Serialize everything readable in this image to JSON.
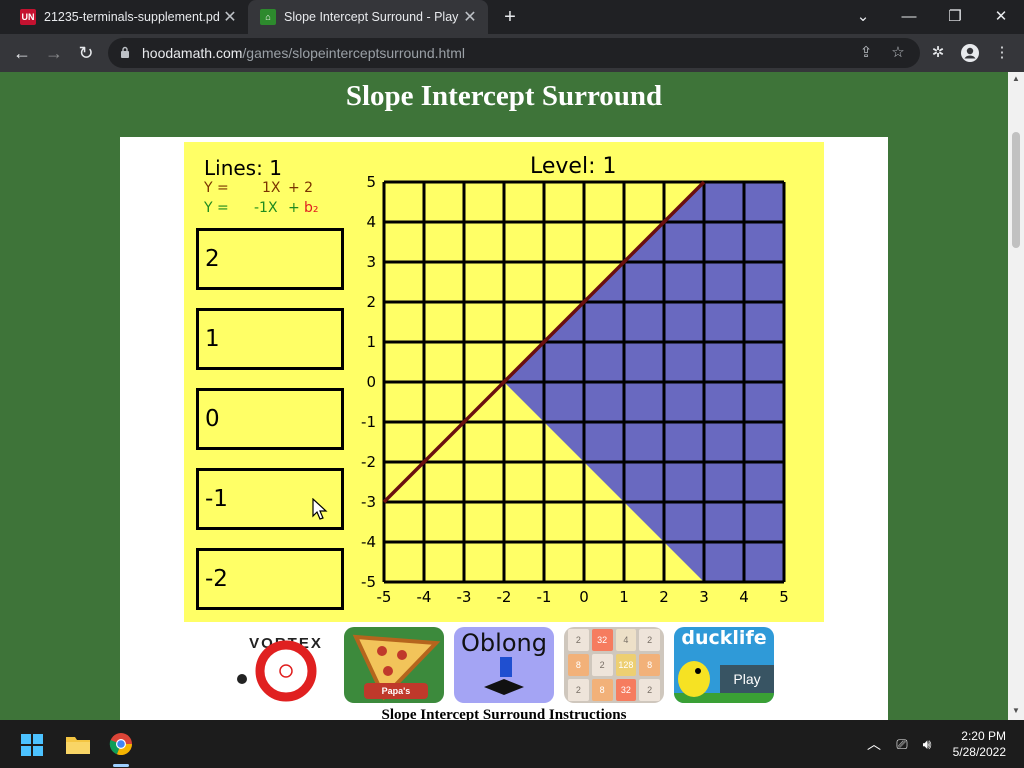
{
  "browser": {
    "tabs": [
      {
        "title": "21235-terminals-supplement.pdf",
        "favicon": "pdf-icon",
        "active": false
      },
      {
        "title": "Slope Intercept Surround - Play S",
        "favicon": "hoodamath-icon",
        "active": true
      }
    ],
    "url_host": "hoodamath.com",
    "url_path": "/games/slopeinterceptsurround.html"
  },
  "page": {
    "title": "Slope Intercept Surround",
    "instructions_heading": "Slope Intercept Surround Instructions"
  },
  "game": {
    "lines_label": "Lines: 1",
    "level_label": "Level: 1",
    "eq1": {
      "y": "Y =",
      "slope": "1X",
      "rest": "+ 2"
    },
    "eq2": {
      "y": "Y =",
      "slope": "-1X",
      "plus": "+",
      "b": "b₂"
    },
    "answers": [
      "2",
      "1",
      "0",
      "-1",
      "-2"
    ],
    "x_ticks": [
      "-5",
      "-4",
      "-3",
      "-2",
      "-1",
      "0",
      "1",
      "2",
      "3",
      "4",
      "5"
    ],
    "y_ticks": [
      "5",
      "4",
      "3",
      "2",
      "1",
      "0",
      "-1",
      "-2",
      "-3",
      "-4",
      "-5"
    ],
    "fixed_line": {
      "slope": 1,
      "intercept": 2
    },
    "shaded_region": [
      [
        -2,
        0
      ],
      [
        3,
        5
      ],
      [
        5,
        5
      ],
      [
        5,
        -5
      ],
      [
        3,
        -5
      ]
    ],
    "colors": {
      "background": "#ffff66",
      "shade": "#5c5cc8",
      "line": "#6b0f0f",
      "grid": "#000000"
    }
  },
  "thumbnails": [
    {
      "name": "vortex",
      "label": "VORTEX"
    },
    {
      "name": "papas-pizzeria",
      "label": "Papa's Pizzeria"
    },
    {
      "name": "oblong",
      "label": "Oblong"
    },
    {
      "name": "2048",
      "cells": [
        "2",
        "32",
        "4",
        "2",
        "8",
        "2",
        "128",
        "8",
        "2",
        "8",
        "32",
        "2"
      ]
    },
    {
      "name": "ducklife",
      "label": "ducklife",
      "play": "Play"
    }
  ],
  "taskbar": {
    "time": "2:20 PM",
    "date": "5/28/2022"
  }
}
